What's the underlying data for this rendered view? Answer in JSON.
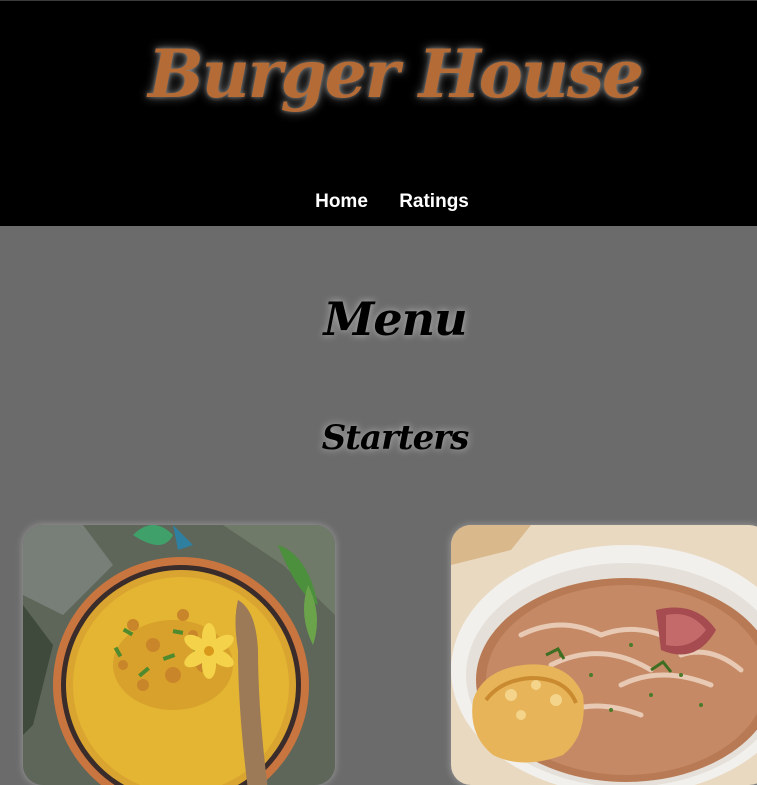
{
  "header": {
    "brand": "Burger House",
    "nav": [
      {
        "label": "Home"
      },
      {
        "label": "Ratings"
      }
    ]
  },
  "main": {
    "title": "Menu",
    "sections": [
      {
        "title": "Starters",
        "items": [
          {
            "image": "yellow-curry-soup-bowl"
          },
          {
            "image": "french-onion-soup-bowl"
          }
        ]
      }
    ]
  },
  "colors": {
    "header_bg": "#000000",
    "page_bg": "#6b6b6b",
    "brand": "#b46b35",
    "nav_text": "#ffffff"
  }
}
